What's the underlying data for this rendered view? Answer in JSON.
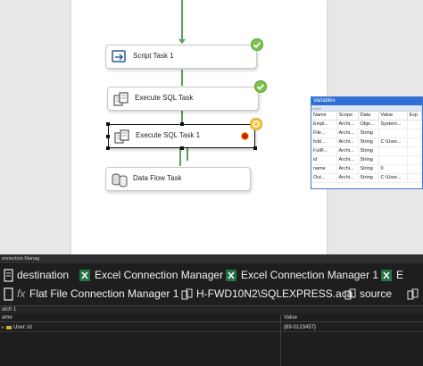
{
  "tasks": [
    {
      "label": "Script Task 1",
      "status": "success"
    },
    {
      "label": "Execute SQL Task",
      "status": "success"
    },
    {
      "label": "Execute SQL Task 1",
      "status": "running"
    },
    {
      "label": "Data Flow Task",
      "status": "none"
    }
  ],
  "variables": {
    "title": "Variables",
    "columns": [
      "Name",
      "Scope",
      "Data",
      "Value",
      "Exp"
    ],
    "rows": [
      {
        "name": "Empl...",
        "scope": "Archi...",
        "type": "Obje...",
        "value": "System..."
      },
      {
        "name": "File...",
        "scope": "Archi...",
        "type": "String",
        "value": ""
      },
      {
        "name": "fold...",
        "scope": "Archi...",
        "type": "String",
        "value": "C:\\User..."
      },
      {
        "name": "FullF...",
        "scope": "Archi...",
        "type": "String",
        "value": ""
      },
      {
        "name": "id",
        "scope": "Archi...",
        "type": "String",
        "value": ""
      },
      {
        "name": "name",
        "scope": "Archi...",
        "type": "String",
        "value": "0"
      },
      {
        "name": "Out...",
        "scope": "Archi...",
        "type": "String",
        "value": "C:\\User..."
      }
    ]
  },
  "connection_managers": {
    "title": "onnection Manag",
    "row1": [
      "destination",
      "Excel Connection Manager",
      "Excel Connection Manager 1"
    ],
    "row2": [
      "Flat File Connection Manager 1",
      "H-FWD10N2\\SQLEXPRESS.aca",
      "source"
    ],
    "row2_prefix": "fx"
  },
  "watch": {
    "title": "atch 1",
    "col_name": "ame",
    "col_value": "Value",
    "row_name": "User::id",
    "row_value": "{69-0123457}"
  },
  "colors": {
    "success": "#7cc24e",
    "running": "#f4c542",
    "connector": "#58a15a",
    "variables_title": "#2f6fd2"
  }
}
